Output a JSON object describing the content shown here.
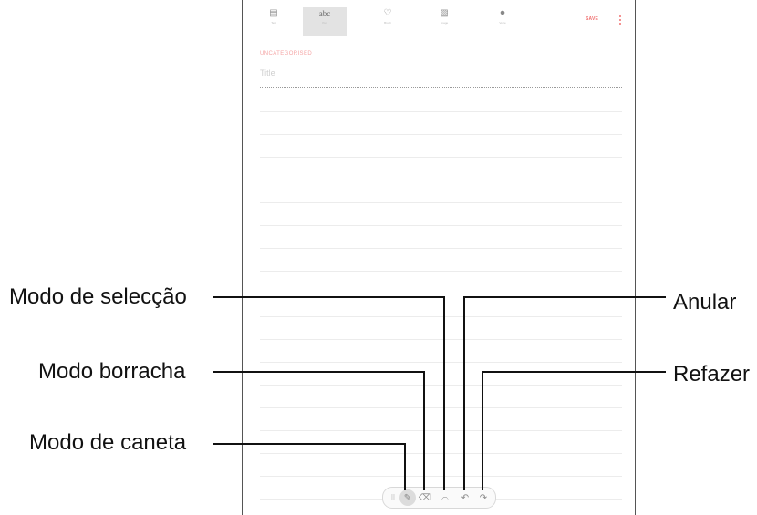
{
  "toolbar": {
    "tools": [
      {
        "icon": "text-icon",
        "glyph": "▤",
        "label": "Text"
      },
      {
        "icon": "handwriting-icon",
        "glyph": "abc",
        "label": "Pen"
      },
      {
        "icon": "brush-icon",
        "glyph": "♡",
        "label": "Brush"
      },
      {
        "icon": "image-icon",
        "glyph": "▨",
        "label": "Image"
      },
      {
        "icon": "mic-icon",
        "glyph": "⏺",
        "label": "Voice"
      }
    ],
    "save_label": "SAVE"
  },
  "note": {
    "category": "UNCATEGORISED",
    "title_placeholder": "Title"
  },
  "pen_tools": {
    "grip_glyph": "⠿",
    "pen_glyph": "✎",
    "eraser_glyph": "⌫",
    "selection_glyph": "⌓",
    "undo_glyph": "↶",
    "redo_glyph": "↷"
  },
  "callouts": {
    "selection_mode": "Modo de selecção",
    "eraser_mode": "Modo borracha",
    "pen_mode": "Modo de caneta",
    "undo": "Anular",
    "redo": "Refazer"
  }
}
